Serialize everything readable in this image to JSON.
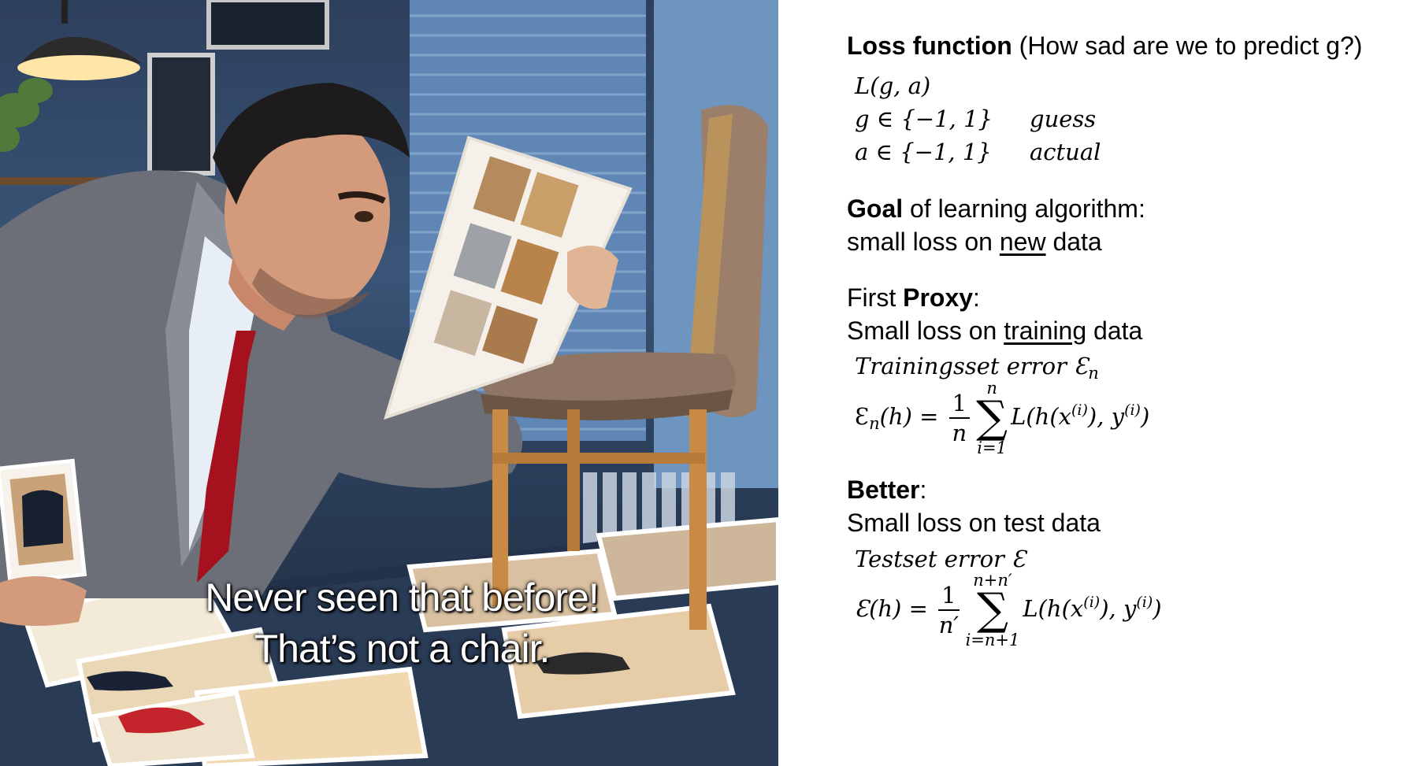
{
  "illustration": {
    "caption_line_1": "Never seen that before!",
    "caption_line_2": "That’s not a chair."
  },
  "slide": {
    "loss_heading_bold": "Loss function",
    "loss_heading_rest": " (How sad are we to predict g?)",
    "loss_signature": "L(g, a)",
    "guess_def": "g  ∈ {−1, 1}",
    "guess_label": "guess",
    "actual_def": "a  ∈ {−1, 1}",
    "actual_label": "actual",
    "goal_bold": "Goal",
    "goal_rest": " of learning algorithm:",
    "goal_line2_pre": "small loss on ",
    "goal_line2_underlined": "new",
    "goal_line2_post": " data",
    "proxy_pre": "First ",
    "proxy_bold": "Proxy",
    "proxy_post": ":",
    "proxy_line2_pre": "Small loss on ",
    "proxy_line2_underlined": "training",
    "proxy_line2_post": " data",
    "training_error_label": "Trainingsset error Ɛ",
    "training_error_sub": "n",
    "training_formula": {
      "lhs": "Ɛ",
      "lhs_sub": "n",
      "lhs_arg": "(h) =",
      "frac_num": "1",
      "frac_den": "n",
      "sum_upper": "n",
      "sum_lower": "i=1",
      "summand_a": "L(h(x",
      "sup_i": "(i)",
      "summand_b": "), y",
      "summand_c": ")"
    },
    "better_bold": "Better",
    "better_post": ":",
    "better_line2": "Small loss on test data",
    "test_error_label": "Testset error Ɛ",
    "test_formula": {
      "lhs": "Ɛ(h) =",
      "frac_num": "1",
      "frac_den": "n′",
      "sum_upper": "n+n′",
      "sum_lower": "i=n+1",
      "summand_a": "L(h(x",
      "sup_i": "(i)",
      "summand_b": "), y",
      "summand_c": ")"
    }
  }
}
